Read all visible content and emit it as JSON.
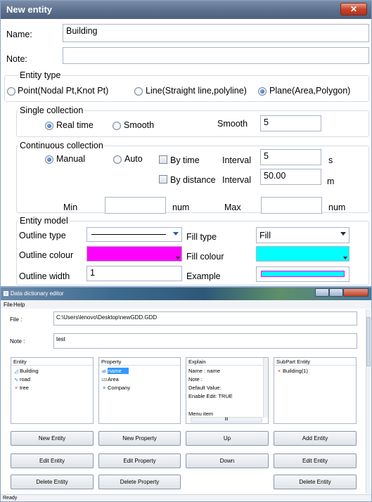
{
  "dialog": {
    "title": "New entity",
    "close_glyph": "✕",
    "name_label": "Name:",
    "name_value": "Building",
    "note_label": "Note:",
    "note_value": "",
    "entity_type": {
      "title": "Entity type",
      "options": [
        "Point(Nodal Pt,Knot Pt)",
        "Line(Straight line,polyline)",
        "Plane(Area,Polygon)"
      ],
      "selected": "Plane(Area,Polygon)"
    },
    "single": {
      "title": "Single collection",
      "options": [
        "Real time",
        "Smooth"
      ],
      "selected": "Real time",
      "smooth_label": "Smooth",
      "smooth_value": "5"
    },
    "continuous": {
      "title": "Continuous collection",
      "manual": "Manual",
      "auto": "Auto",
      "selected": "Manual",
      "by_time": "By time",
      "by_distance": "By distance",
      "interval_label": "Interval",
      "interval_time": "5",
      "unit_time": "s",
      "interval_distance": "50.00",
      "unit_distance": "m",
      "min_label": "Min",
      "min_unit": "num",
      "max_label": "Max",
      "max_unit": "num"
    },
    "model": {
      "title": "Entity model",
      "outline_type": "Outline type",
      "fill_type": "Fill type",
      "fill_value": "Fill",
      "outline_colour": "Outline colour",
      "fill_colour": "Fill colour",
      "outline_width": "Outline width",
      "outline_width_value": "1",
      "example": "Example",
      "outline_colour_hex": "#ff00ff",
      "fill_colour_hex": "#00ffff"
    }
  },
  "editor": {
    "title": "Data dictionary editor",
    "menu": [
      "File",
      "Help"
    ],
    "file_label": "File :",
    "file_value": "C:\\Users\\lenovo\\Desktop\\newGDD.GDD",
    "note_label": "Note :",
    "note_value": "test",
    "entity_header": "Entity",
    "entities": [
      {
        "icon": "polygon-icon",
        "glyph": "◿",
        "name": "Building"
      },
      {
        "icon": "line-icon",
        "glyph": "∿",
        "name": "road"
      },
      {
        "icon": "point-icon",
        "glyph": "×",
        "name": "tree"
      }
    ],
    "property_header": "Property",
    "properties": [
      {
        "icon": "text-field-icon",
        "glyph": "ab",
        "name": "name",
        "selected": true
      },
      {
        "icon": "number-field-icon",
        "glyph": "123",
        "name": "Area",
        "selected": false
      },
      {
        "icon": "list-field-icon",
        "glyph": "≡",
        "name": "Company",
        "selected": false
      }
    ],
    "explain_header": "Explain",
    "explain_lines": [
      "Name :     name",
      "Note :",
      "Default Value:",
      "Enable Edit:  TRUE",
      "",
      "Menu item"
    ],
    "explain_hscroll": "III",
    "subpart_header": "SubPart Entity",
    "subparts": [
      {
        "glyph": "×",
        "name": "Building(1)"
      }
    ],
    "buttons": {
      "new_entity": "New Entity",
      "new_property": "New Property",
      "up": "Up",
      "add_entity": "Add Entity",
      "edit_entity": "Edit Entity",
      "edit_property": "Edit Property",
      "down": "Down",
      "edit_entity_2": "Edit Entity",
      "delete_entity": "Delete Entity",
      "delete_property": "Delete Property",
      "delete_entity_2": "Delete Entity"
    },
    "status": "Ready"
  }
}
